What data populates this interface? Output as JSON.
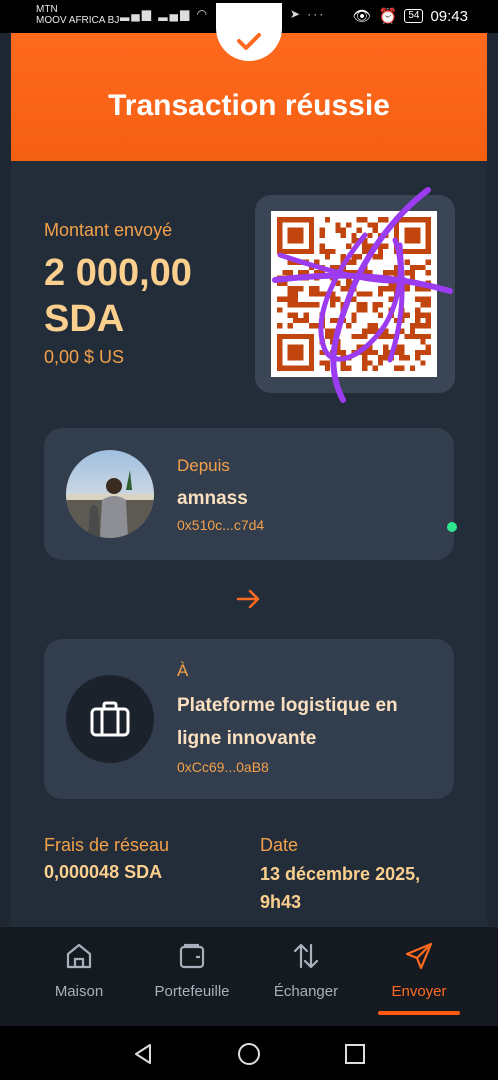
{
  "status_bar": {
    "carrier_1": "MTN",
    "carrier_2": "MOOV AFRICA BJ",
    "battery": "54",
    "time": "09:43"
  },
  "header": {
    "title": "Transaction réussie"
  },
  "amount": {
    "label": "Montant envoyé",
    "value": "2 000,00 SDA",
    "usd": "0,00 $ US"
  },
  "from": {
    "role": "Depuis",
    "name": "amnass",
    "address": "0x510c...c7d4",
    "avatar_icon": "user-photo-icon"
  },
  "to": {
    "role": "À",
    "name": "Plateforme logistique en ligne innovante",
    "address": "0xCc69...0aB8",
    "icon": "briefcase-icon"
  },
  "details": {
    "fee_label": "Frais de réseau",
    "fee_value": "0,000048 SDA",
    "date_label": "Date",
    "date_value": "13 décembre 2025, 9h43"
  },
  "bottom_nav": {
    "items": [
      {
        "label": "Maison",
        "icon": "home-icon"
      },
      {
        "label": "Portefeuille",
        "icon": "wallet-icon"
      },
      {
        "label": "Échanger",
        "icon": "swap-icon"
      },
      {
        "label": "Envoyer",
        "icon": "send-icon",
        "active": true
      }
    ]
  },
  "colors": {
    "accent": "#ff6a1f",
    "background": "#232c39",
    "card": "#323d4d",
    "label_orange": "#f2a14a",
    "value_light": "#fbd08f",
    "online_dot": "#2ee68e"
  }
}
